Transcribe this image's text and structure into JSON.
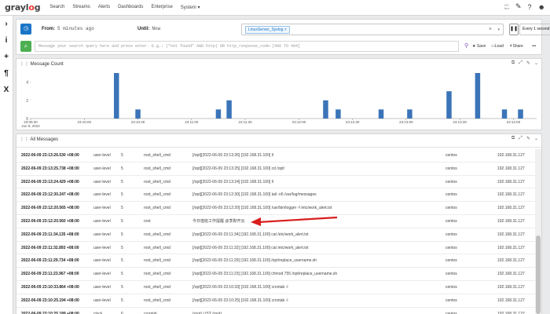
{
  "nav": {
    "logo_pre": "grayl",
    "logo_o": "o",
    "logo_post": "g",
    "links": [
      "Search",
      "Streams",
      "Alerts",
      "Dashboards",
      "Enterprise",
      "System ▾"
    ],
    "tz_line1": "HY",
    "tz_line2": "bur"
  },
  "sidebar": {
    "icons": [
      "›",
      "i",
      "+",
      "¶",
      "X"
    ]
  },
  "search": {
    "from_label": "From:",
    "from_value": "5 minutes ago",
    "until_label": "Until:",
    "until_value": "Now",
    "stream_tag": "LinuxServer_Syslog",
    "stream_tag_remove": "×",
    "clear": "×",
    "caret": "▾",
    "refresh_label": "Every 1 second ▾",
    "query_placeholder": "Message your search query here and press enter. E.g.: (\"not found\" AND http) OR http_response_code:[400 TO 404]",
    "save_label": "Save",
    "load_label": "Load",
    "share_label": "Share",
    "more_label": "•••"
  },
  "message_count": {
    "title": "Message Count"
  },
  "chart_data": {
    "type": "bar",
    "title": "",
    "xlabel": "",
    "ylabel": "",
    "ylim": [
      0,
      5
    ],
    "yticks": [
      0,
      2,
      4
    ],
    "x_ticks": [
      "23:09:30\nJun 9, 2022",
      "23:10:00",
      "23:10:30",
      "23:11:00",
      "23:11:30",
      "23:12:00",
      "23:12:30",
      "23:13:00",
      "23:13:30",
      "23:14:00"
    ],
    "bars": [
      {
        "x": "23:10:18",
        "value": 5
      },
      {
        "x": "23:10:30",
        "value": 1
      },
      {
        "x": "23:11:15",
        "value": 1
      },
      {
        "x": "23:11:21",
        "value": 2
      },
      {
        "x": "23:12:15",
        "value": 2
      },
      {
        "x": "23:12:22",
        "value": 1
      },
      {
        "x": "23:12:46",
        "value": 1
      },
      {
        "x": "23:13:02",
        "value": 1
      },
      {
        "x": "23:13:24",
        "value": 3
      },
      {
        "x": "23:13:40",
        "value": 5
      },
      {
        "x": "23:13:55",
        "value": 1
      },
      {
        "x": "23:14:04",
        "value": 1
      }
    ],
    "color": "#3b74b8",
    "grid": false
  },
  "all_messages": {
    "title": "All Messages",
    "rows": [
      {
        "ts": "2022-06-09 23:13:26.530 +08:00",
        "fac": "user-level",
        "lvl": "5",
        "src": "root_shell_cmd",
        "msg": "[/opt][2022-06-09 23:13:26] [192.168.31.100] ll",
        "host": "centos",
        "ip": "192.168.31.127"
      },
      {
        "ts": "2022-06-09 23:13:25.738 +08:00",
        "fac": "user-level",
        "lvl": "5",
        "src": "root_shell_cmd",
        "msg": "[/opt][2022-06-09 23:13:25] [192.168.31.100] cd /opt/",
        "host": "centos",
        "ip": "192.168.31.127"
      },
      {
        "ts": "2022-06-09 23:13:24.429 +08:00",
        "fac": "user-level",
        "lvl": "5",
        "src": "root_shell_cmd",
        "msg": "[/opt][2022-06-09 23:13:24] [192.168.31.100] ll",
        "host": "centos",
        "ip": "192.168.31.127"
      },
      {
        "ts": "2022-06-09 23:12:30.247 +08:00",
        "fac": "user-level",
        "lvl": "5",
        "src": "root_shell_cmd",
        "msg": "[/opt][2022-06-09 23:12:30] [192.168.31.100] tail -n5 /var/log/messages",
        "host": "centos",
        "ip": "192.168.31.127"
      },
      {
        "ts": "2022-06-09 23:12:20.565 +08:00",
        "fac": "user-level",
        "lvl": "5",
        "src": "root_shell_cmd",
        "msg": "[/opt][2022-06-09 23:12:20] [192.168.31.100] /usr/bin/logger -f /etc/work_alert.txt",
        "host": "centos",
        "ip": "192.168.31.127"
      },
      {
        "ts": "2022-06-09 23:12:20.560 +08:00",
        "fac": "user-level",
        "lvl": "5",
        "src": "root",
        "msg": "今日值班工作提醒 @李默开云",
        "host": "centos",
        "ip": "192.168.31.127"
      },
      {
        "ts": "2022-06-09 23:11:34.135 +08:00",
        "fac": "user-level",
        "lvl": "5",
        "src": "root_shell_cmd",
        "msg": "[/opt][2022-06-09 23:11:34] [192.168.31.100] cat /etc/work_alert.txt",
        "host": "centos",
        "ip": "192.168.31.127"
      },
      {
        "ts": "2022-06-09 23:11:32.893 +08:00",
        "fac": "user-level",
        "lvl": "5",
        "src": "root_shell_cmd",
        "msg": "[/opt][2022-06-09 23:11:32] [192.168.31.100] cat /etc/work_alert.txt",
        "host": "centos",
        "ip": "192.168.31.127"
      },
      {
        "ts": "2022-06-09 23:11:29.734 +08:00",
        "fac": "user-level",
        "lvl": "5",
        "src": "root_shell_cmd",
        "msg": "[/opt][2022-06-09 23:11:29] [192.168.31.100] /opt/replace_username.sh",
        "host": "centos",
        "ip": "192.168.31.127"
      },
      {
        "ts": "2022-06-09 23:11:23.967 +08:00",
        "fac": "user-level",
        "lvl": "5",
        "src": "root_shell_cmd",
        "msg": "[/opt][2022-06-09 23:11:23] [192.168.31.100] chmod 755 /opt/replace_username.sh",
        "host": "centos",
        "ip": "192.168.31.127"
      },
      {
        "ts": "2022-06-09 23:10:33.864 +08:00",
        "fac": "user-level",
        "lvl": "5",
        "src": "root_shell_cmd",
        "msg": "[/opt][2022-06-09 23:10:33] [192.168.31.100] crontab -l",
        "host": "centos",
        "ip": "192.168.31.127"
      },
      {
        "ts": "2022-06-09 23:10:25.194 +08:00",
        "fac": "user-level",
        "lvl": "5",
        "src": "root_shell_cmd",
        "msg": "[/opt][2022-06-09 23:10:25] [192.168.31.100] crontab -l",
        "host": "centos",
        "ip": "192.168.31.127"
      },
      {
        "ts": "2022-06-09 23:10:25.189 +08:00",
        "fac": "clock",
        "lvl": "6",
        "src": "crontab",
        "msg": "(root) LIST (root)",
        "host": "centos",
        "ip": "192.168.31.127"
      }
    ]
  },
  "colors": {
    "primary": "#1a75c6",
    "success": "#4caf50",
    "bar": "#3b74b8",
    "arrow": "#d91d1d",
    "logo_accent": "#ff3633"
  }
}
